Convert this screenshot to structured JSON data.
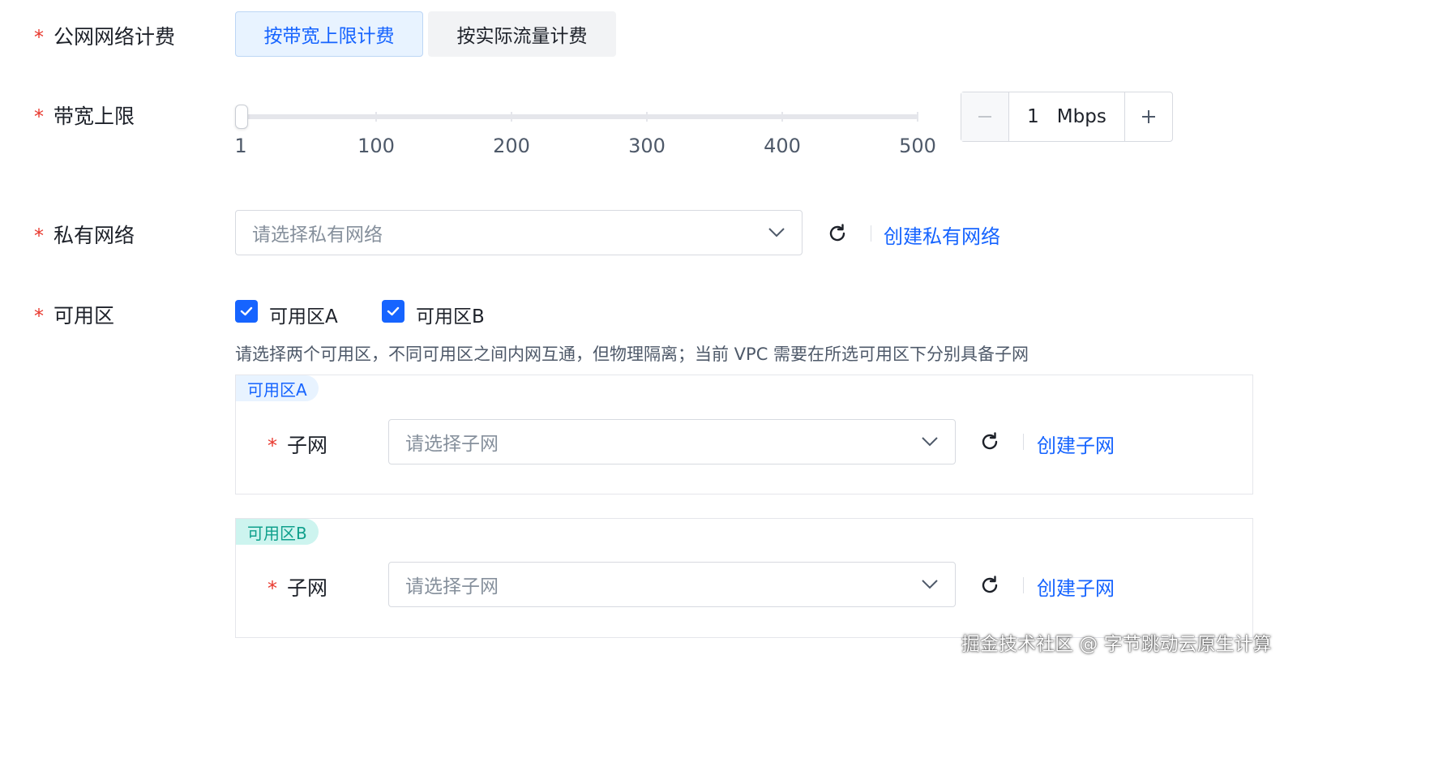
{
  "billing": {
    "label": "公网网络计费",
    "options": [
      "按带宽上限计费",
      "按实际流量计费"
    ],
    "selected": "按带宽上限计费"
  },
  "bandwidth": {
    "label": "带宽上限",
    "slider_min": 1,
    "slider_max": 500,
    "tick_labels": [
      "1",
      "100",
      "200",
      "300",
      "400",
      "500"
    ],
    "value": "1",
    "unit": "Mbps",
    "minus_icon": "minus-icon",
    "plus_icon": "plus-icon"
  },
  "vpc": {
    "label": "私有网络",
    "placeholder": "请选择私有网络",
    "create_link": "创建私有网络"
  },
  "zones": {
    "label": "可用区",
    "options": [
      {
        "label": "可用区A",
        "checked": true
      },
      {
        "label": "可用区B",
        "checked": true
      }
    ],
    "hint": "请选择两个可用区，不同可用区之间内网互通，但物理隔离；当前 VPC 需要在所选可用区下分别具备子网"
  },
  "zone_panels": [
    {
      "tag": "可用区A",
      "tag_color": "#e8f3ff",
      "tag_text_color": "#1664ff",
      "subnet_label": "子网",
      "placeholder": "请选择子网",
      "create_link": "创建子网"
    },
    {
      "tag": "可用区B",
      "tag_color": "#cdf4ef",
      "tag_text_color": "#0fa08c",
      "subnet_label": "子网",
      "placeholder": "请选择子网",
      "create_link": "创建子网"
    }
  ],
  "watermark": "掘金技术社区 @ 字节跳动云原生计算",
  "colors": {
    "accent": "#1664ff",
    "required": "#e8382e"
  }
}
